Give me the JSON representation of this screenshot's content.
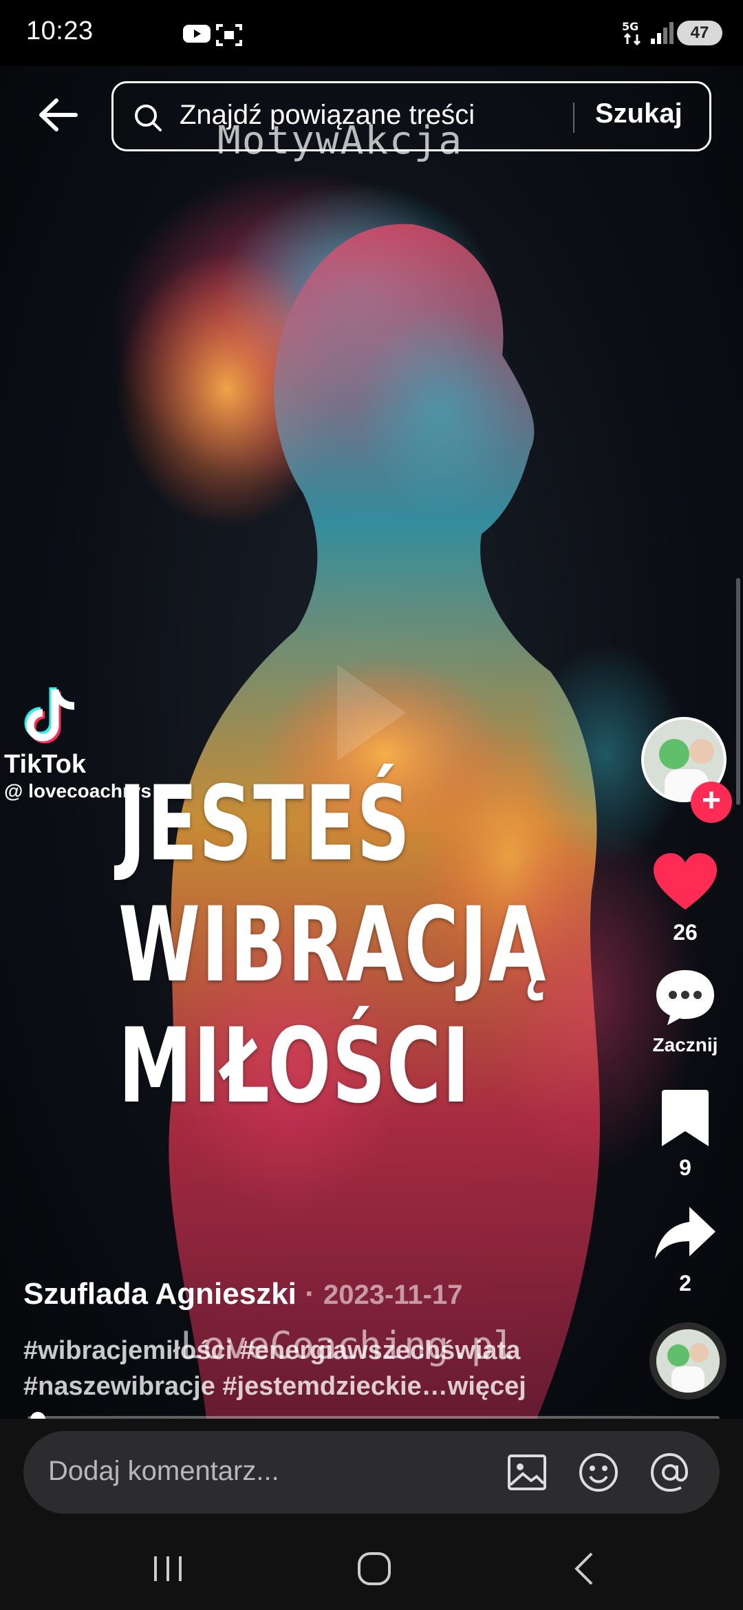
{
  "status_bar": {
    "time": "10:23",
    "battery": "47",
    "icons": [
      "youtube-icon",
      "screenshot-icon",
      "5g-icon",
      "signal-icon",
      "battery-icon"
    ]
  },
  "search": {
    "placeholder": "Znajdź powiązane treści",
    "button": "Szukaj"
  },
  "video": {
    "watermark_top": "MotywAkcja",
    "title_lines": [
      "JESTEŚ",
      "WIBRACJĄ",
      "MIŁOŚCI"
    ],
    "tiktok_word": "TikTok",
    "tiktok_handle": "@ lovecoachrys",
    "watermark_bottom": "LoveCoaching.pl"
  },
  "actions": {
    "likes": "26",
    "comments_label": "Zacznij",
    "saves": "9",
    "shares": "2"
  },
  "caption": {
    "author": "Szuflada Agnieszki",
    "separator": "·",
    "date": "2023-11-17",
    "line1": "#wibracjemiłości #energiawszechświata",
    "line2": "#naszewibracje #jestemdzieckie…więcej"
  },
  "comment": {
    "placeholder": "Dodaj komentarz..."
  },
  "progress": 0.01,
  "colors": {
    "like_red": "#fe2c55",
    "background": "#000000",
    "comment_bar": "#2c2c2e"
  }
}
